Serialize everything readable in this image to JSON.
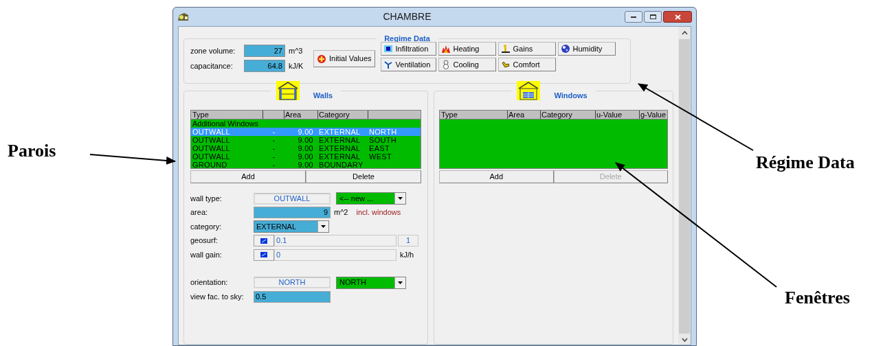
{
  "window": {
    "title": "CHAMBRE"
  },
  "regime": {
    "title": "Regime Data",
    "quantities": [
      {
        "label": "zone volume:",
        "value": "27",
        "unit": "m^3"
      },
      {
        "label": "capacitance:",
        "value": "64.8",
        "unit": "kJ/K"
      }
    ],
    "initial_button": "Initial Values",
    "buttons": [
      {
        "label": "Infiltration",
        "kind": "infiltration"
      },
      {
        "label": "Heating",
        "kind": "heating"
      },
      {
        "label": "Gains",
        "kind": "gains"
      },
      {
        "label": "Humidity",
        "kind": "humidity"
      },
      {
        "label": "Ventilation",
        "kind": "ventilation"
      },
      {
        "label": "Cooling",
        "kind": "cooling"
      },
      {
        "label": "Comfort",
        "kind": "comfort"
      }
    ]
  },
  "walls": {
    "title": "Walls",
    "columns": [
      "Type",
      "Area",
      "Category"
    ],
    "rows": [
      {
        "kind": "group",
        "label": "Additional Windows",
        "selected": false
      },
      {
        "kind": "item",
        "cells": [
          "OUTWALL",
          "-",
          "9.00",
          "EXTERNAL",
          "NORTH"
        ],
        "selected": true
      },
      {
        "kind": "item",
        "cells": [
          "OUTWALL",
          "-",
          "9.00",
          "EXTERNAL",
          "SOUTH"
        ],
        "selected": false
      },
      {
        "kind": "item",
        "cells": [
          "OUTWALL",
          "-",
          "9.00",
          "EXTERNAL",
          "EAST"
        ],
        "selected": false
      },
      {
        "kind": "item",
        "cells": [
          "OUTWALL",
          "-",
          "9.00",
          "EXTERNAL",
          "WEST"
        ],
        "selected": false
      },
      {
        "kind": "item",
        "cells": [
          "GROUND",
          "-",
          "9.00",
          "BOUNDARY"
        ],
        "selected": false
      }
    ],
    "buttons": [
      {
        "label": "Add",
        "disabled": false
      },
      {
        "label": "Delete",
        "disabled": false
      }
    ],
    "properties": [
      {
        "kind": "display_select",
        "label": "wall type:",
        "display": "OUTWALL",
        "select": "<-- new ..."
      },
      {
        "kind": "number",
        "label": "area:",
        "value": "9",
        "unit": "m^2",
        "note": "incl. windows"
      },
      {
        "kind": "select",
        "label": "category:",
        "value": "EXTERNAL"
      },
      {
        "kind": "picker",
        "label": "geosurf:",
        "value": "0.1",
        "extra": "1"
      },
      {
        "kind": "picker",
        "label": "wall gain:",
        "value": "0",
        "unit": "kJ/h"
      }
    ],
    "orientation": [
      {
        "kind": "display_select",
        "label": "orientation:",
        "display": "NORTH",
        "select": "NORTH"
      },
      {
        "kind": "text",
        "label": "view fac. to sky:",
        "value": "0.5"
      }
    ]
  },
  "windows": {
    "title": "Windows",
    "columns": [
      "Type",
      "Area",
      "Category",
      "u-Value",
      "g-Value"
    ],
    "buttons": [
      {
        "label": "Add",
        "disabled": false
      },
      {
        "label": "Delete",
        "disabled": true
      }
    ]
  },
  "annotations": [
    {
      "text": "Parois"
    },
    {
      "text": "Régime Data"
    },
    {
      "text": "Fenêtres"
    }
  ]
}
